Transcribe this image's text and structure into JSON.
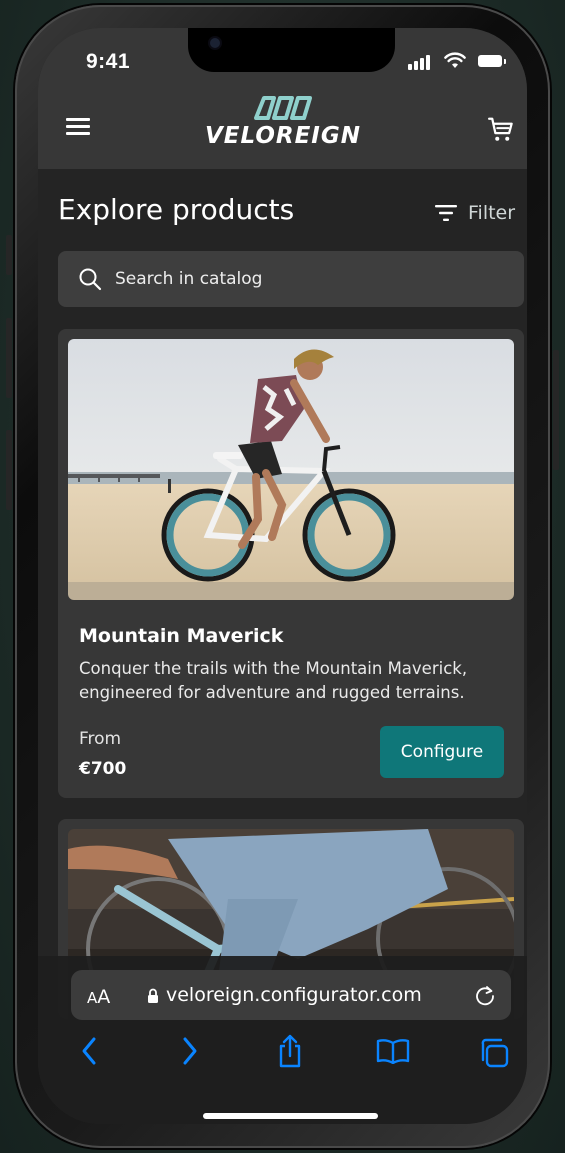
{
  "status_bar": {
    "time": "9:41"
  },
  "header": {
    "brand": "VELOREIGN",
    "menu_icon": "hamburger-menu-icon",
    "cart_icon": "shopping-cart-icon"
  },
  "main": {
    "title": "Explore products",
    "filter_label": "Filter",
    "search_placeholder": "Search in catalog"
  },
  "products": [
    {
      "name": "Mountain Maverick",
      "description": "Conquer the trails with the Mountain Maverick, engineered for adventure and rugged terrains.",
      "from_label": "From",
      "price": "€700",
      "cta": "Configure"
    }
  ],
  "browser": {
    "text_size_label_small": "A",
    "text_size_label_big": "A",
    "url": "veloreign.configurator.com"
  },
  "colors": {
    "accent": "#0f7779",
    "logo_mark": "#8fd0cc",
    "ios_blue": "#0a84ff",
    "background": "#242424",
    "card": "#373737"
  }
}
